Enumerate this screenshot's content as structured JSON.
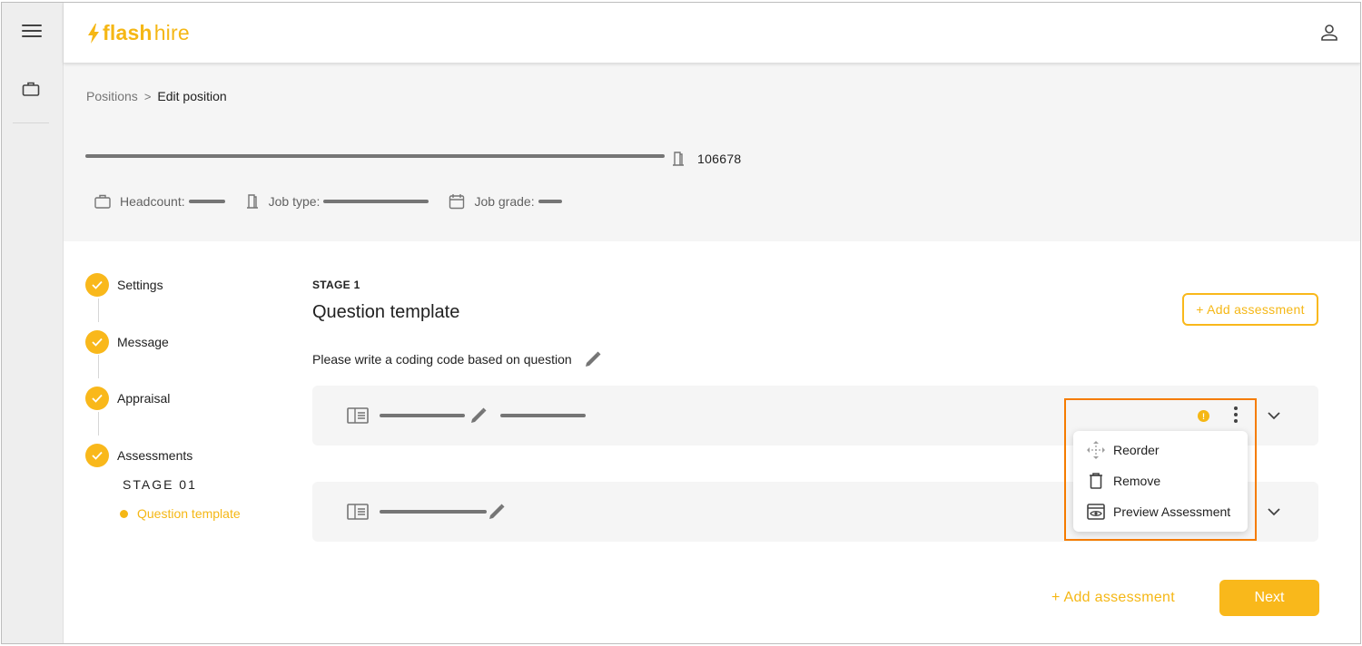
{
  "app": {
    "brand_flash": "flash",
    "brand_hire": "hire"
  },
  "breadcrumb": {
    "parent": "Positions",
    "separator": ">",
    "current": "Edit position"
  },
  "position": {
    "id": "106678",
    "headcount_label": "Headcount:",
    "job_type_label": "Job type:",
    "job_grade_label": "Job grade:"
  },
  "stepper": {
    "steps": [
      {
        "label": "Settings",
        "done": true
      },
      {
        "label": "Message",
        "done": true
      },
      {
        "label": "Appraisal",
        "done": true
      },
      {
        "label": "Assessments",
        "done": true
      }
    ],
    "stage_label": "STAGE 01",
    "sub_step": "Question template"
  },
  "main": {
    "stage_tag": "STAGE 1",
    "title": "Question template",
    "add_assessment_outline": "+ Add assessment",
    "question": "Please write a coding code based on question"
  },
  "cards": [
    {
      "info_badge": "!"
    },
    {}
  ],
  "menu": {
    "items": [
      {
        "label": "Reorder",
        "icon": "move-icon"
      },
      {
        "label": "Remove",
        "icon": "trash-icon"
      },
      {
        "label": "Preview Assessment",
        "icon": "preview-icon"
      }
    ]
  },
  "footer": {
    "add_assessment": "+ Add assessment",
    "next": "Next"
  },
  "colors": {
    "accent": "#f9b81b",
    "highlight": "#f57c00"
  }
}
